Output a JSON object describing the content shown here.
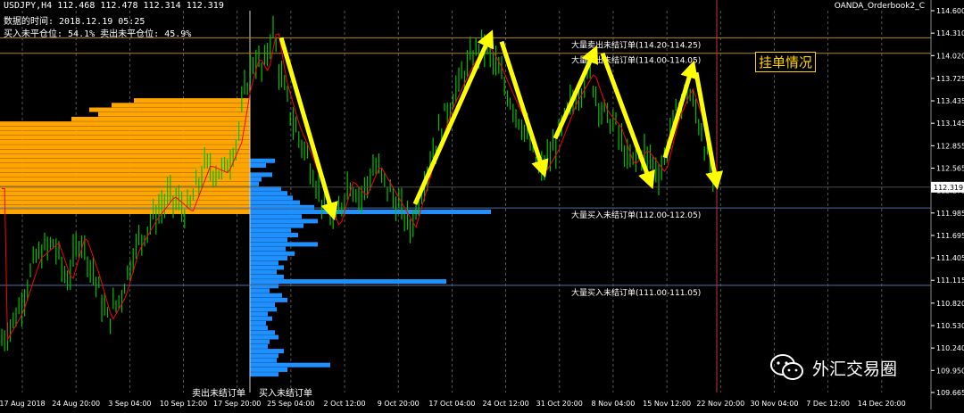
{
  "header": {
    "symbol_line": "USDJPY,H4  112.468 112.478 112.314 112.319",
    "data_time": "数据的时间: 2018.12.19 05:25",
    "position_line": "买入未平仓位: 54.1%  卖出未平仓位: 45.9%",
    "broker": "OANDA_Orderbook2_C"
  },
  "title_box": "挂单情况",
  "watermark": {
    "icon": "wechat-icon",
    "text": "外汇交易圈"
  },
  "bottom_labels": {
    "sell": "卖出未结订单",
    "buy": "买入未结订单"
  },
  "colors": {
    "sell": "#ffa500",
    "buy": "#1e90ff",
    "candle": "#00c000",
    "arrow": "#ffff00",
    "ma": "#ff0000",
    "grid": "#6b6b6b"
  },
  "chart_data": {
    "type": "candlestick",
    "ylim": [
      109.665,
      114.6
    ],
    "y_ticks": [
      "114.600",
      "114.310",
      "114.020",
      "113.725",
      "113.435",
      "113.145",
      "112.855",
      "112.565",
      "112.275",
      "111.985",
      "111.695",
      "111.405",
      "111.115",
      "110.820",
      "110.530",
      "110.240",
      "109.950",
      "109.665"
    ],
    "x_ticks": [
      "17 Aug 2018",
      "24 Aug 20:00",
      "3 Sep 04:00",
      "10 Sep 12:00",
      "17 Sep 20:00",
      "25 Sep 04:00",
      "2 Oct 12:00",
      "9 Oct 20:00",
      "17 Oct 04:00",
      "24 Oct 12:00",
      "31 Oct 20:00",
      "8 Nov 04:00",
      "15 Nov 12:00",
      "22 Nov 20:00",
      "30 Nov 04:00",
      "7 Dec 12:00",
      "14 Dec 20:00"
    ],
    "current_price": "112.319",
    "price_path": [
      [
        0,
        110.3
      ],
      [
        20,
        110.7
      ],
      [
        40,
        111.4
      ],
      [
        60,
        111.6
      ],
      [
        75,
        111.1
      ],
      [
        90,
        111.7
      ],
      [
        105,
        111.2
      ],
      [
        120,
        110.6
      ],
      [
        135,
        110.9
      ],
      [
        150,
        111.5
      ],
      [
        170,
        111.9
      ],
      [
        190,
        112.2
      ],
      [
        210,
        112.0
      ],
      [
        230,
        112.6
      ],
      [
        250,
        112.5
      ],
      [
        265,
        112.9
      ],
      [
        275,
        113.6
      ],
      [
        285,
        114.0
      ],
      [
        295,
        113.8
      ],
      [
        305,
        114.4
      ],
      [
        315,
        113.7
      ],
      [
        330,
        113.1
      ],
      [
        345,
        112.7
      ],
      [
        360,
        112.2
      ],
      [
        375,
        111.8
      ],
      [
        390,
        112.4
      ],
      [
        405,
        112.2
      ],
      [
        420,
        112.6
      ],
      [
        440,
        112.2
      ],
      [
        460,
        111.8
      ],
      [
        480,
        112.6
      ],
      [
        500,
        113.3
      ],
      [
        520,
        113.8
      ],
      [
        540,
        114.2
      ],
      [
        555,
        113.9
      ],
      [
        570,
        113.5
      ],
      [
        590,
        113.0
      ],
      [
        605,
        112.5
      ],
      [
        620,
        112.8
      ],
      [
        640,
        113.4
      ],
      [
        660,
        113.8
      ],
      [
        675,
        113.3
      ],
      [
        690,
        113.1
      ],
      [
        705,
        112.6
      ],
      [
        720,
        112.8
      ],
      [
        740,
        112.5
      ],
      [
        755,
        113.2
      ],
      [
        770,
        113.6
      ],
      [
        785,
        113.1
      ],
      [
        800,
        112.3
      ]
    ],
    "orderbook": {
      "sell_bars": [
        [
          113.44,
          130
        ],
        [
          113.38,
          155
        ],
        [
          113.32,
          180
        ],
        [
          113.26,
          170
        ],
        [
          113.2,
          200
        ],
        [
          113.14,
          280
        ],
        [
          113.08,
          280
        ],
        [
          113.02,
          280
        ],
        [
          112.96,
          280
        ],
        [
          112.9,
          280
        ],
        [
          112.84,
          280
        ],
        [
          112.78,
          280
        ],
        [
          112.72,
          280
        ],
        [
          112.66,
          280
        ],
        [
          112.6,
          280
        ],
        [
          112.54,
          280
        ],
        [
          112.48,
          280
        ],
        [
          112.42,
          280
        ],
        [
          112.36,
          280
        ],
        [
          112.3,
          280
        ],
        [
          112.24,
          280
        ],
        [
          112.18,
          280
        ],
        [
          112.12,
          280
        ],
        [
          112.06,
          280
        ],
        [
          112.0,
          280
        ],
        [
          112.66,
          55
        ],
        [
          112.6,
          30
        ],
        [
          112.54,
          60
        ],
        [
          112.48,
          45
        ]
      ],
      "buy_bars": [
        [
          112.66,
          308
        ],
        [
          112.6,
          298
        ],
        [
          112.48,
          305
        ],
        [
          112.42,
          293
        ],
        [
          112.36,
          290
        ],
        [
          112.3,
          315
        ],
        [
          112.24,
          322
        ],
        [
          112.18,
          328
        ],
        [
          112.12,
          336
        ],
        [
          112.06,
          352
        ],
        [
          112.0,
          550
        ],
        [
          111.94,
          338
        ],
        [
          111.88,
          356
        ],
        [
          111.82,
          340
        ],
        [
          111.76,
          326
        ],
        [
          111.7,
          334
        ],
        [
          111.64,
          322
        ],
        [
          111.58,
          356
        ],
        [
          111.52,
          320
        ],
        [
          111.46,
          330
        ],
        [
          111.4,
          322
        ],
        [
          111.34,
          312
        ],
        [
          111.28,
          318
        ],
        [
          111.22,
          310
        ],
        [
          111.16,
          318
        ],
        [
          111.1,
          500
        ],
        [
          111.04,
          312
        ],
        [
          110.98,
          302
        ],
        [
          110.92,
          316
        ],
        [
          110.86,
          322
        ],
        [
          110.8,
          308
        ],
        [
          110.74,
          310
        ],
        [
          110.68,
          300
        ],
        [
          110.62,
          305
        ],
        [
          110.56,
          298
        ],
        [
          110.5,
          300
        ],
        [
          110.44,
          308
        ],
        [
          110.38,
          312
        ],
        [
          110.32,
          302
        ],
        [
          110.26,
          300
        ],
        [
          110.2,
          318
        ],
        [
          110.14,
          312
        ],
        [
          110.08,
          310
        ],
        [
          110.02,
          370
        ],
        [
          109.96,
          322
        ],
        [
          109.9,
          312
        ]
      ]
    },
    "levels": [
      {
        "price": 114.25,
        "label": "大量卖出未结订单(114.20-114.25)"
      },
      {
        "price": 114.05,
        "label": "大量卖出未结订单(114.00-114.05)"
      },
      {
        "price": 112.05,
        "label": "大量买入未结订单(112.00-112.05)"
      },
      {
        "price": 111.05,
        "label": "大量买入未结订单(111.00-111.05)"
      }
    ],
    "arrows": [
      [
        [
          315,
          114.25
        ],
        [
          372,
          112.0
        ]
      ],
      [
        [
          465,
          112.1
        ],
        [
          548,
          114.25
        ]
      ],
      [
        [
          562,
          114.2
        ],
        [
          608,
          112.55
        ]
      ],
      [
        [
          622,
          112.95
        ],
        [
          665,
          114.05
        ]
      ],
      [
        [
          675,
          114.05
        ],
        [
          728,
          112.4
        ]
      ],
      [
        [
          745,
          112.7
        ],
        [
          775,
          113.85
        ]
      ],
      [
        [
          780,
          113.8
        ],
        [
          802,
          112.4
        ]
      ]
    ]
  }
}
